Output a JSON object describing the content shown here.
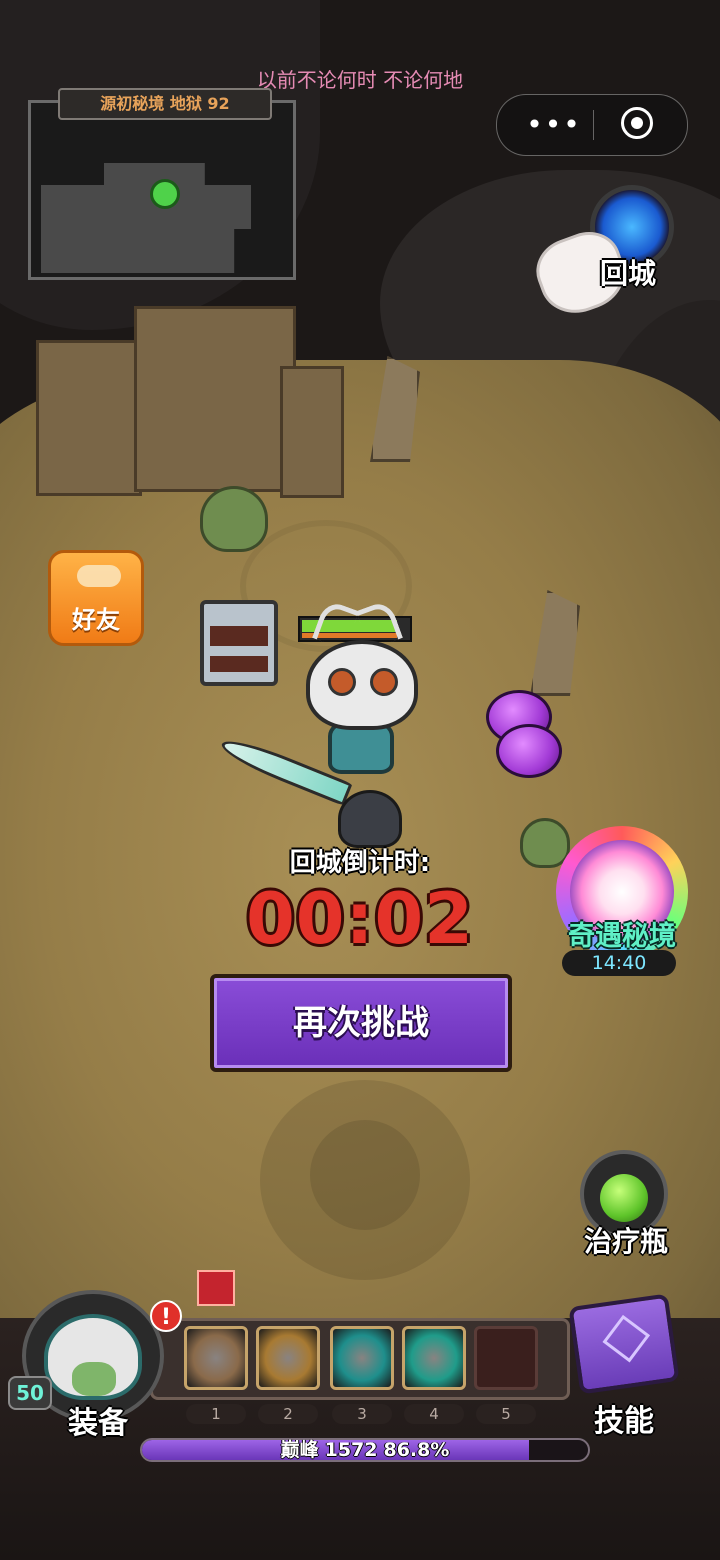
{
  "top": {
    "song_lyric": "以前不论何时 不论何地"
  },
  "minimap": {
    "title": "源初秘境 地狱 92"
  },
  "buttons": {
    "return_city": "回城",
    "friends": "好友",
    "retry": "再次挑战",
    "potion": "治疗瓶",
    "equipment": "装备",
    "skills": "技能"
  },
  "countdown": {
    "label": "回城倒计时:",
    "time": "00:02"
  },
  "adventure": {
    "label": "奇遇秘境",
    "timer": "14:40"
  },
  "hero": {
    "hp_fraction": 0.9,
    "level": "50"
  },
  "skill_bar": {
    "slots": [
      {
        "num": "1",
        "icon": "rock-smash-icon",
        "color": "#8a6a4a"
      },
      {
        "num": "2",
        "icon": "golden-claw-icon",
        "color": "#a87a32"
      },
      {
        "num": "3",
        "icon": "lightning-icon",
        "color": "#1e8f8c"
      },
      {
        "num": "4",
        "icon": "spirit-orb-icon",
        "color": "#1f9c8a"
      },
      {
        "num": "5",
        "icon": "empty-slot",
        "color": "#3a1f1d"
      }
    ]
  },
  "xp": {
    "rank": "巅峰",
    "level": "1572",
    "percent_text": "86.8%",
    "fraction": 0.868
  },
  "colors": {
    "retry_button": "#7a3fc8",
    "countdown": "#e5332a",
    "adventure_label": "#5ff0c6",
    "xp_fill": "#8a52d8"
  }
}
